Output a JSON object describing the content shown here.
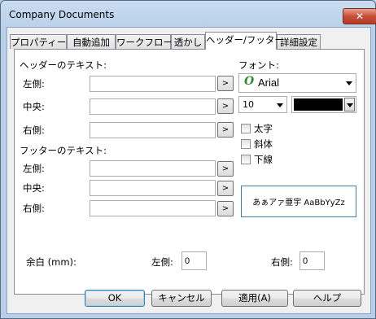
{
  "window": {
    "title": "Company Documents",
    "close_glyph": "✕"
  },
  "tabs": [
    {
      "label": "プロパティー",
      "active": false
    },
    {
      "label": "自動追加",
      "active": false
    },
    {
      "label": "ワークフロー",
      "active": false
    },
    {
      "label": "透かし",
      "active": false
    },
    {
      "label": "ヘッダー/フッター",
      "active": true
    },
    {
      "label": "詳細設定",
      "active": false
    }
  ],
  "header": {
    "section_label": "ヘッダーのテキスト:",
    "left_label": "左側:",
    "center_label": "中央:",
    "right_label": "右側:",
    "left_value": "",
    "center_value": "",
    "right_value": ""
  },
  "footer": {
    "section_label": "フッターのテキスト:",
    "left_label": "左側:",
    "center_label": "中央:",
    "right_label": "右側:",
    "left_value": "",
    "center_value": "",
    "right_value": ""
  },
  "arrow_button_label": ">",
  "font": {
    "section_label": "フォント:",
    "family": "Arial",
    "size": "10",
    "color": "#000000",
    "bold_label": "太字",
    "italic_label": "斜体",
    "underline_label": "下線",
    "bold": false,
    "italic": false,
    "underline": false,
    "preview_text": "あぁアァ亜宇 AaBbYyZz"
  },
  "margin": {
    "label": "余白 (mm):",
    "left_label": "左側:",
    "left_value": "0",
    "right_label": "右側:",
    "right_value": "0"
  },
  "buttons": {
    "ok": "OK",
    "cancel": "キャンセル",
    "apply": "適用(A)",
    "help": "ヘルプ"
  }
}
